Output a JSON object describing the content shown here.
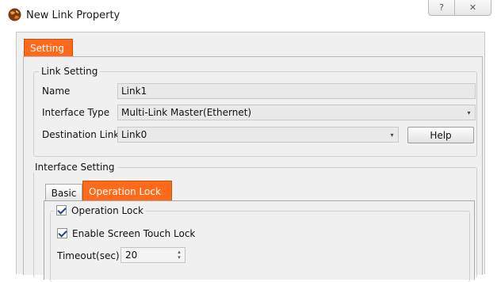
{
  "window": {
    "title": "New Link Property",
    "help_glyph": "?",
    "close_glyph": "✕",
    "icon": "app-globe-icon"
  },
  "tabs": {
    "setting_label": "Setting"
  },
  "link_setting": {
    "group_label": "Link Setting",
    "name_label": "Name",
    "name_value": "Link1",
    "interface_type_label": "Interface Type",
    "interface_type_value": "Multi-Link Master(Ethernet)",
    "destination_link_label": "Destination Link",
    "destination_link_value": "Link0",
    "help_button": "Help",
    "dropdown_glyph": "▾"
  },
  "interface_setting": {
    "group_label": "Interface Setting",
    "tabs": [
      {
        "label": "Basic",
        "active": false
      },
      {
        "label": "Operation Lock",
        "active": true
      }
    ],
    "operation_lock": {
      "label": "Operation Lock",
      "checked": true,
      "enable_touch_lock_label": "Enable Screen Touch Lock",
      "enable_touch_lock_checked": true,
      "timeout_label": "Timeout(sec)",
      "timeout_value": "20",
      "spin_up_glyph": "▴",
      "spin_down_glyph": "▾"
    }
  },
  "colors": {
    "accent_orange": "#ff6a1a",
    "panel_bg": "#f0f0f0"
  }
}
